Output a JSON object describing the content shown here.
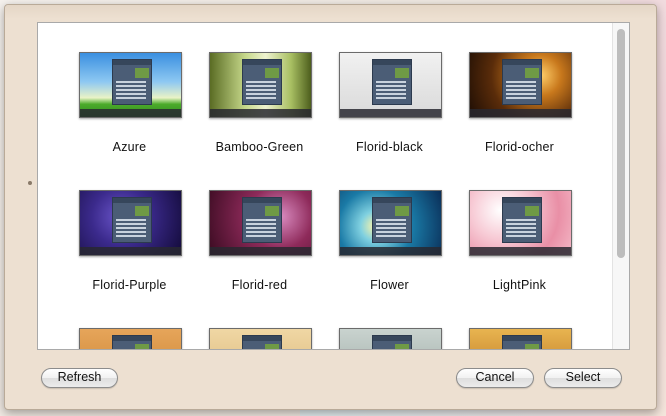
{
  "themes": [
    {
      "label": "Azure",
      "style": "t-azure"
    },
    {
      "label": "Bamboo-Green",
      "style": "t-bamboo"
    },
    {
      "label": "Florid-black",
      "style": "t-black"
    },
    {
      "label": "Florid-ocher",
      "style": "t-ocher"
    },
    {
      "label": "Florid-Purple",
      "style": "t-purple"
    },
    {
      "label": "Florid-red",
      "style": "t-red"
    },
    {
      "label": "Flower",
      "style": "t-flower"
    },
    {
      "label": "LightPink",
      "style": "t-pink"
    },
    {
      "label": "",
      "style": "t-row3a"
    },
    {
      "label": "",
      "style": "t-row3b"
    },
    {
      "label": "",
      "style": "t-row3c"
    },
    {
      "label": "",
      "style": "t-row3d"
    }
  ],
  "buttons": {
    "refresh": "Refresh",
    "cancel": "Cancel",
    "select": "Select"
  },
  "colors": {
    "dialog_background": "#ede0d1",
    "panel_background": "#ffffff"
  }
}
